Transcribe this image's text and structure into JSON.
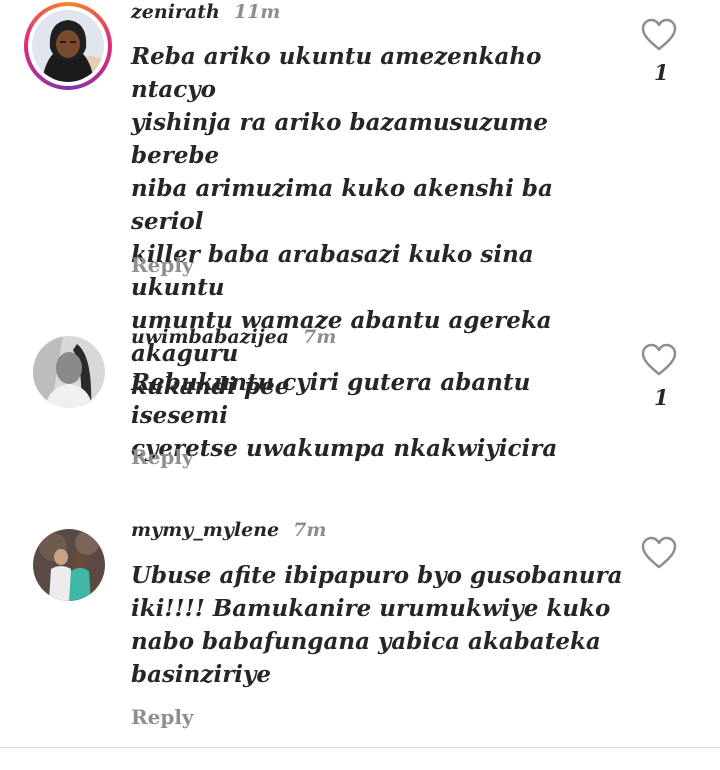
{
  "comments": [
    {
      "username": "zenirath",
      "time": "11m",
      "text": "Reba ariko ukuntu amezenkaho ntacyo\nyishinja ra ariko bazamusuzume berebe\nniba arimuzima kuko akenshi ba seriol\nkiller baba arabasazi  kuko sina ukuntu\numuntu wamaze abantu agereka akaguru\nkukandi pee",
      "reply_label": "Reply",
      "like_count": "1",
      "has_story_ring": true
    },
    {
      "username": "uwimbabazijea",
      "time": "7m",
      "text": "Rebukuntu cyiri gutera abantu isesemi\ncyeretse uwakumpa nkakwiyicira",
      "reply_label": "Reply",
      "like_count": "1",
      "has_story_ring": false
    },
    {
      "username": "mymy_mylene",
      "time": "7m",
      "text": "Ubuse afite ibipapuro byo gusobanura\niki!!!! Bamukanire urumukwiye kuko\nnabo babafungana yabica akabateka\nbasinziriye",
      "reply_label": "Reply",
      "like_count": "",
      "has_story_ring": false
    }
  ],
  "colors": {
    "text": "#262626",
    "secondary": "#8e8e8e",
    "ring_start": "#f58529",
    "ring_mid": "#dd2a7b",
    "ring_end": "#8134af"
  }
}
